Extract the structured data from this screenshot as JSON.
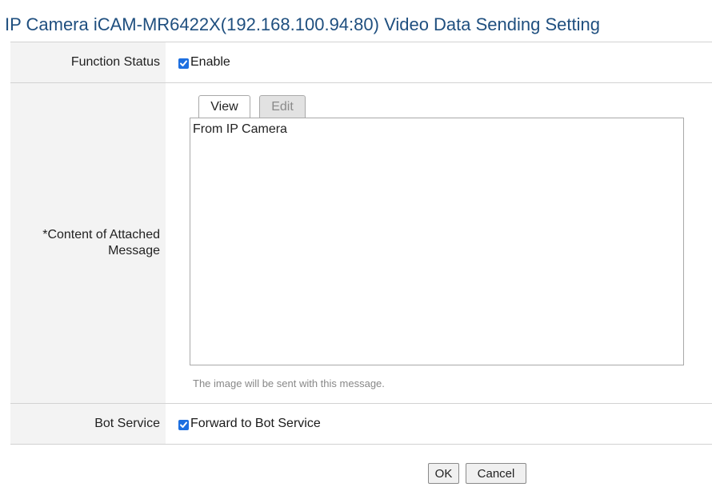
{
  "page": {
    "title": "IP Camera iCAM-MR6422X(192.168.100.94:80) Video Data Sending Setting"
  },
  "function_status": {
    "label": "Function Status",
    "checkbox_label": "Enable",
    "checked": true
  },
  "message": {
    "label": "*Content of Attached Message",
    "tabs": [
      {
        "label": "View",
        "active": true
      },
      {
        "label": "Edit",
        "active": false
      }
    ],
    "content": "From IP Camera",
    "hint": "The image will be sent with this message."
  },
  "bot_service": {
    "label": "Bot Service",
    "checkbox_label": "Forward to Bot Service",
    "checked": true
  },
  "buttons": {
    "ok": "OK",
    "cancel": "Cancel"
  },
  "colors": {
    "title": "#1f4f7f",
    "checkbox": "#1d6fe0",
    "label_bg": "#f3f3f3"
  }
}
